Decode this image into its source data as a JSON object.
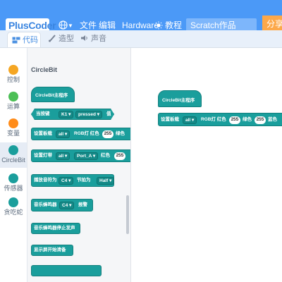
{
  "topbar": {
    "logo_text": "PlusCoder",
    "menu_file": "文件",
    "menu_edit": "编辑",
    "menu_hardware": "Hardware",
    "menu_tutorial": "教程",
    "project_name": "Scratch作品",
    "share": "分享",
    "colors": {
      "bar": "#4b99f7",
      "share": "#fca84a"
    }
  },
  "tabs": [
    {
      "label": "代码",
      "icon": "code-icon"
    },
    {
      "label": "造型",
      "icon": "brush-icon"
    },
    {
      "label": "声音",
      "icon": "speaker-icon"
    }
  ],
  "categories": [
    {
      "label": "控制",
      "color": "#f5a623"
    },
    {
      "label": "运算",
      "color": "#4cbf56"
    },
    {
      "label": "变量",
      "color": "#ff8c1a"
    },
    {
      "label": "CircleBit",
      "color": "#1a9e9c"
    },
    {
      "label": "传感器",
      "color": "#1a9e9c"
    },
    {
      "label": "贪吃蛇",
      "color": "#1a9e9c"
    }
  ],
  "palette": {
    "title": "CircleBit",
    "blocks": [
      {
        "text": "CircleBit主程序"
      },
      {
        "prefix": "当按键",
        "key": "K1",
        "event": "pressed",
        "suffix": "值"
      },
      {
        "prefix": "设置板载",
        "target": "all",
        "mid": "RGB灯 红色",
        "red": "255",
        "green_label": "绿色"
      },
      {
        "prefix": "设置灯带",
        "target": "all",
        "port": "Port_A",
        "mid": "红色",
        "red": "255"
      },
      {
        "prefix": "播放音符为",
        "note": "C4",
        "mid": "节拍为",
        "beat": "Half"
      },
      {
        "prefix": "音乐蜂鸣器",
        "note": "C4",
        "suffix": "报警"
      },
      {
        "text": "音乐蜂鸣器停止发声"
      },
      {
        "text": "显示屏开始清备"
      }
    ]
  },
  "workspace": {
    "hat_text": "CircleBit主程序",
    "set_prefix": "设置板载",
    "target": "all",
    "mid": "RGB灯 红色",
    "red": "255",
    "green_label": "绿色",
    "green": "255",
    "blue_label": "蓝色"
  }
}
